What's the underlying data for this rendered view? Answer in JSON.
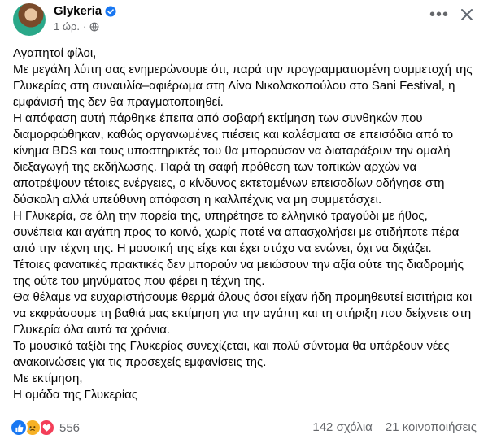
{
  "post": {
    "author": "Glykeria",
    "time": "1 ώρ.",
    "dot": "·",
    "paragraphs": [
      "Αγαπητοί φίλοι,",
      "Με μεγάλη λύπη σας ενημερώνουμε ότι, παρά την προγραμματισμένη συμμετοχή της Γλυκερίας στη συναυλία–αφιέρωμα στη Λίνα Νικολακοπούλου στο Sani Festival, η εμφάνισή της δεν θα πραγματοποιηθεί.",
      "Η απόφαση αυτή πάρθηκε έπειτα από σοβαρή εκτίμηση των συνθηκών που διαμορφώθηκαν, καθώς οργανωμένες πιέσεις και καλέσματα σε επεισόδια από το κίνημα BDS και τους υποστηρικτές του θα μπορούσαν να διαταράξουν την ομαλή διεξαγωγή της εκδήλωσης. Παρά τη σαφή πρόθεση των τοπικών αρχών να αποτρέψουν τέτοιες ενέργειες, ο κίνδυνος εκτεταμένων επεισοδίων οδήγησε στη δύσκολη αλλά υπεύθυνη απόφαση η καλλιτέχνις να μη συμμετάσχει.",
      "Η Γλυκερία, σε όλη την πορεία της, υπηρέτησε το ελληνικό τραγούδι με ήθος, συνέπεια και αγάπη προς το κοινό, χωρίς ποτέ να απασχολήσει με οτιδήποτε πέρα από την τέχνη της. Η μουσική της είχε και έχει στόχο να ενώνει, όχι να διχάζει.",
      "Τέτοιες φανατικές πρακτικές δεν μπορούν να μειώσουν την αξία ούτε της διαδρομής της ούτε του μηνύματος που φέρει η τέχνη της.",
      "Θα θέλαμε να ευχαριστήσουμε θερμά όλους όσοι είχαν ήδη προμηθευτεί εισιτήρια και να εκφράσουμε τη βαθιά μας εκτίμηση για την αγάπη και τη στήριξη που δείχνετε στη Γλυκερία όλα αυτά τα χρόνια.",
      "Το μουσικό ταξίδι της Γλυκερίας συνεχίζεται, και πολύ σύντομα θα υπάρξουν νέες ανακοινώσεις για τις προσεχείς εμφανίσεις της.",
      "Με εκτίμηση,",
      "Η ομάδα της Γλυκερίας"
    ],
    "reaction_count": "556",
    "comments": "142 σχόλια",
    "shares": "21 κοινοποιήσεις"
  },
  "icons": {
    "verified": "verified-badge-icon",
    "audience": "globe-icon",
    "more": "more-options-icon",
    "close": "close-icon",
    "reactions": [
      "like-icon",
      "sad-icon",
      "love-icon"
    ]
  },
  "colors": {
    "brand_blue": "#1877f2",
    "secondary_text": "#65676b",
    "sad_yellow": "#f7b125",
    "love_red": "#f33e58"
  }
}
